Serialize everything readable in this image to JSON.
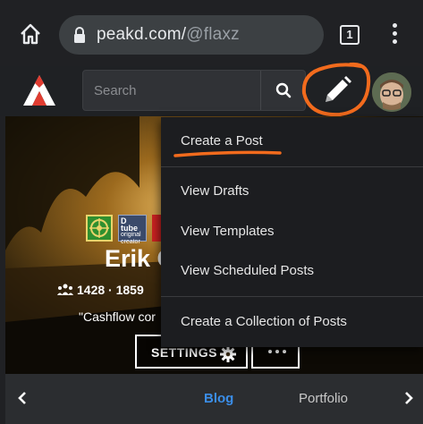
{
  "browser": {
    "url_host": "peakd.com/",
    "url_path": "@flaxz",
    "tab_count": "1"
  },
  "header": {
    "search_placeholder": "Search"
  },
  "profile": {
    "badge_dtube_title": "D tube",
    "badge_dtube_sub": "original creator",
    "name": "Erik G",
    "stats": "1428 · 1859",
    "about": "\"Cashflow cor",
    "settings_label": "SETTINGS"
  },
  "dropdown": {
    "items": [
      "Create a Post",
      "View Drafts",
      "View Templates",
      "View Scheduled Posts",
      "Create a Collection of Posts"
    ]
  },
  "tabs": {
    "blog": "Blog",
    "portfolio": "Portfolio"
  },
  "colors": {
    "annotation": "#f26b1d",
    "active_tab": "#3b8ee8",
    "logo_red": "#e03c31"
  }
}
